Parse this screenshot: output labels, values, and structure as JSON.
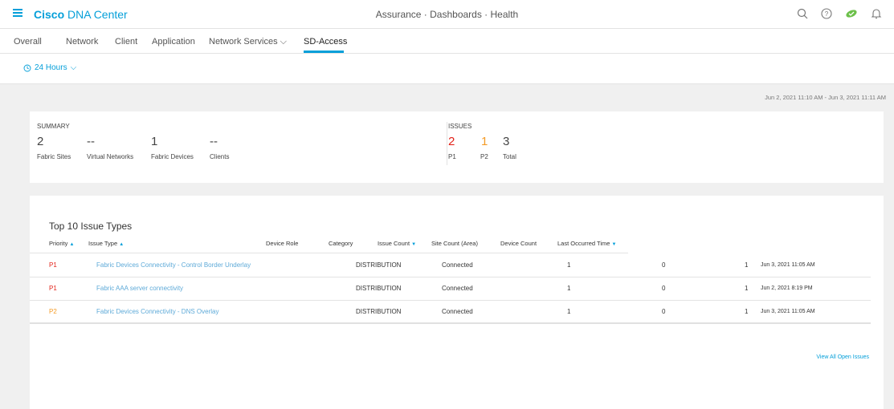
{
  "header": {
    "brand_bold": "Cisco",
    "brand_rest": " DNA Center",
    "breadcrumb": "Assurance · Dashboards · Health",
    "icons": [
      "search-icon",
      "help-icon",
      "status-toggle-icon",
      "bell-icon"
    ]
  },
  "tabs": [
    {
      "label": "Overall"
    },
    {
      "label": "Network"
    },
    {
      "label": "Client"
    },
    {
      "label": "Application"
    },
    {
      "label": "Network Services"
    },
    {
      "label": "SD-Access"
    }
  ],
  "time_filter": {
    "label": "24 Hours"
  },
  "date_range": "Jun 2, 2021 11:10 AM - Jun 3, 2021 11:11 AM",
  "summary": {
    "heading": "SUMMARY",
    "fabric_sites": {
      "value": "2",
      "label": "Fabric Sites"
    },
    "virtual_networks": {
      "value": "--",
      "label": "Virtual Networks"
    },
    "fabric_devices": {
      "value": "1",
      "label": "Fabric Devices"
    },
    "clients": {
      "value": "--",
      "label": "Clients"
    }
  },
  "issues": {
    "heading": "ISSUES",
    "p1": {
      "value": "2",
      "label": "P1"
    },
    "p2": {
      "value": "1",
      "label": "P2"
    },
    "total": {
      "value": "3",
      "label": "Total"
    }
  },
  "top_issues": {
    "title": "Top 10 Issue Types",
    "columns": {
      "priority": "Priority",
      "issue_type": "Issue Type",
      "device_role": "Device Role",
      "category": "Category",
      "issue_count": "Issue Count",
      "site_count": "Site Count (Area)",
      "device_count": "Device Count",
      "last_occurred": "Last Occurred Time"
    },
    "rows": [
      {
        "priority": "P1",
        "issue_type": "Fabric Devices Connectivity - Control Border Underlay",
        "device_role": "DISTRIBUTION",
        "category": "Connected",
        "issue_count": "1",
        "site_count": "0",
        "device_count": "1",
        "last_occurred": "Jun 3, 2021 11:05 AM"
      },
      {
        "priority": "P1",
        "issue_type": "Fabric AAA server connectivity",
        "device_role": "DISTRIBUTION",
        "category": "Connected",
        "issue_count": "1",
        "site_count": "0",
        "device_count": "1",
        "last_occurred": "Jun 2, 2021 8:19 PM"
      },
      {
        "priority": "P2",
        "issue_type": "Fabric Devices Connectivity - DNS Overlay",
        "device_role": "DISTRIBUTION",
        "category": "Connected",
        "issue_count": "1",
        "site_count": "0",
        "device_count": "1",
        "last_occurred": "Jun 3, 2021 11:05 AM"
      }
    ],
    "view_all": "View All Open Issues"
  },
  "colors": {
    "accent": "#049fd9",
    "p1": "#e2231a",
    "p2": "#f49b26",
    "health_ok": "#6cc04a"
  }
}
